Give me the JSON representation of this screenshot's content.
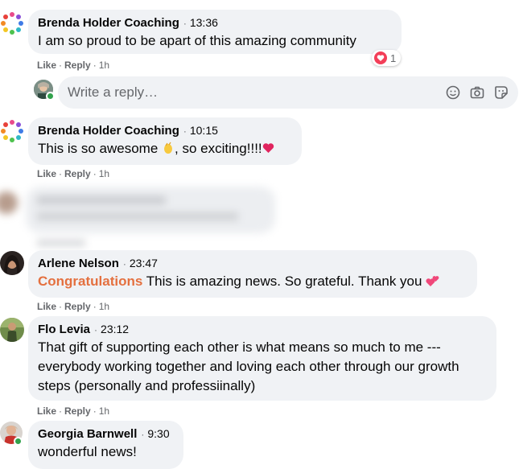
{
  "comments": [
    {
      "author": "Brenda Holder Coaching",
      "time": "13:36",
      "text": "I am so proud to be apart of this amazing community",
      "like": "Like",
      "reply": "Reply",
      "age": "1h",
      "reaction_count": "1"
    },
    {
      "author": "Brenda Holder Coaching",
      "time": "10:15",
      "text_before": "This is so awesome ",
      "text_after": ", so exciting!!!!",
      "like": "Like",
      "reply": "Reply",
      "age": "1h"
    },
    {
      "author": "Arlene Nelson",
      "time": "23:47",
      "highlight": "Congratulations",
      "text": " This is amazing news. So grateful. Thank you ",
      "like": "Like",
      "reply": "Reply",
      "age": "1h"
    },
    {
      "author": "Flo Levia",
      "time": "23:12",
      "text": "That gift of supporting each other is what means so much to me --- everybody working together and loving each other through our growth steps (personally and professiinally)",
      "like": "Like",
      "reply": "Reply",
      "age": "1h"
    },
    {
      "author": "Georgia Barnwell",
      "time": "9:30",
      "text": "wonderful news!"
    }
  ],
  "reply_box": {
    "placeholder": "Write a reply…"
  },
  "colors": {
    "bubble": "#f0f2f5",
    "meta": "#65676b",
    "highlight": "#e4703f",
    "online": "#31a24c",
    "heart": "#f33e58"
  },
  "icons": [
    "emoji-icon",
    "camera-icon",
    "sticker-icon",
    "heart-reaction-icon",
    "clapping-hands-emoji",
    "red-heart-emoji",
    "two-hearts-emoji"
  ]
}
